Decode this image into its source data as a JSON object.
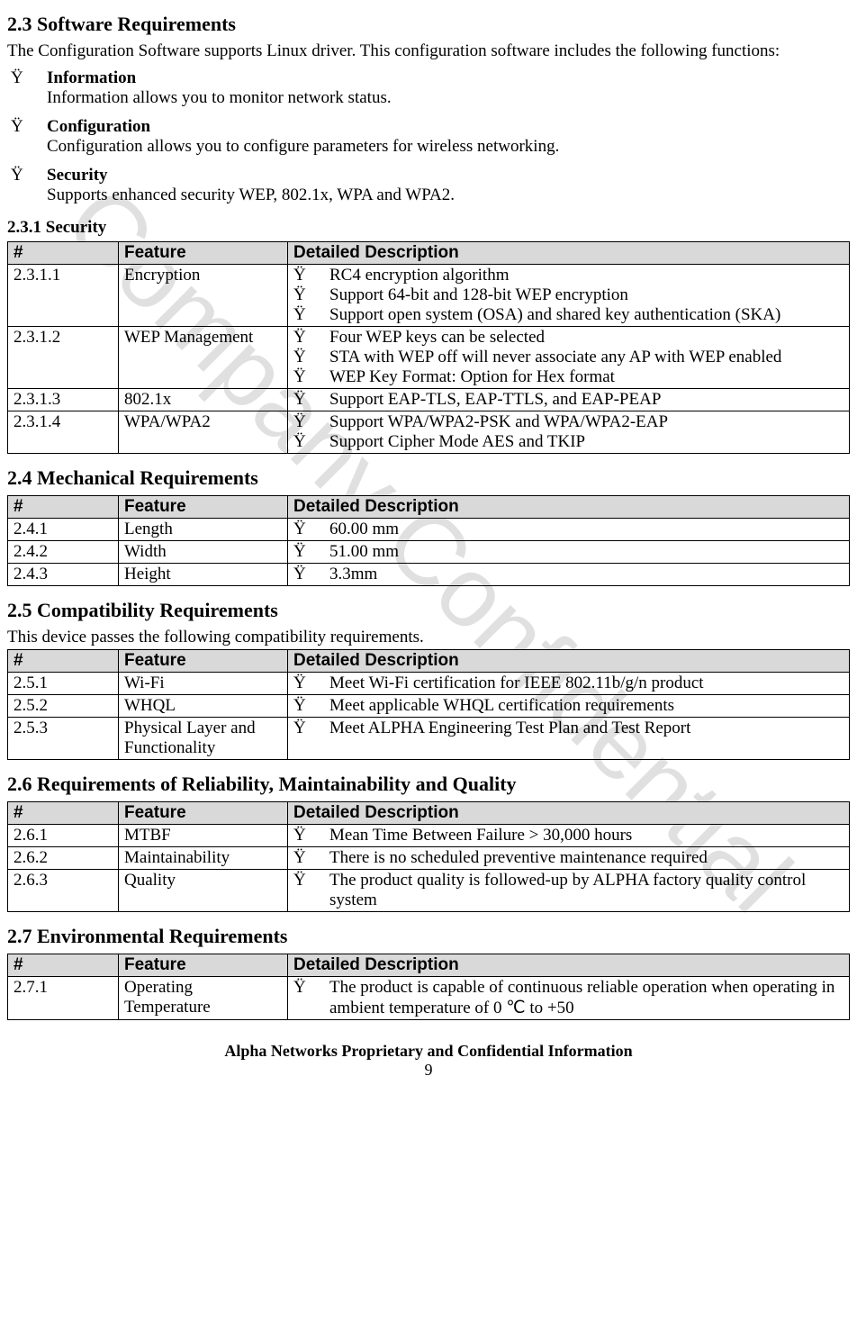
{
  "watermark": "Company Confidential",
  "sec23": {
    "title": "2.3 Software Requirements",
    "intro": "The Configuration Software supports Linux driver. This configuration software includes the following functions:",
    "features": [
      {
        "title": "Information",
        "desc": "Information allows you to monitor network status."
      },
      {
        "title": "Configuration",
        "desc": "Configuration allows you to configure parameters for wireless networking."
      },
      {
        "title": "Security",
        "desc": "Supports enhanced security WEP, 802.1x, WPA and WPA2."
      }
    ],
    "sub231": {
      "title": "2.3.1 Security",
      "headers": [
        "#",
        "Feature",
        "Detailed Description"
      ],
      "rows": [
        {
          "id": "2.3.1.1",
          "feature": "Encryption",
          "items": [
            "RC4 encryption algorithm",
            "Support 64-bit and 128-bit WEP encryption",
            "Support open system (OSA) and shared key authentication (SKA)"
          ]
        },
        {
          "id": "2.3.1.2",
          "feature": "WEP Management",
          "items": [
            "Four WEP keys can be selected",
            "STA with WEP off will never associate any AP with WEP enabled",
            "WEP Key Format: Option for Hex format"
          ]
        },
        {
          "id": "2.3.1.3",
          "feature": "802.1x",
          "items": [
            "Support EAP-TLS, EAP-TTLS, and EAP-PEAP"
          ]
        },
        {
          "id": "2.3.1.4",
          "feature": "WPA/WPA2",
          "items": [
            "Support WPA/WPA2-PSK and WPA/WPA2-EAP",
            "Support Cipher Mode AES and TKIP"
          ]
        }
      ]
    }
  },
  "sec24": {
    "title": "2.4 Mechanical Requirements",
    "headers": [
      "#",
      "Feature",
      "Detailed Description"
    ],
    "rows": [
      {
        "id": "2.4.1",
        "feature": "Length",
        "items": [
          "60.00 mm"
        ]
      },
      {
        "id": "2.4.2",
        "feature": "Width",
        "items": [
          "51.00 mm"
        ]
      },
      {
        "id": "2.4.3",
        "feature": "Height",
        "items": [
          "3.3mm"
        ]
      }
    ]
  },
  "sec25": {
    "title": "2.5 Compatibility Requirements",
    "intro": "This device passes the following compatibility requirements.",
    "headers": [
      "#",
      "Feature",
      "Detailed Description"
    ],
    "rows": [
      {
        "id": "2.5.1",
        "feature": "Wi-Fi",
        "items": [
          "Meet Wi-Fi certification for IEEE 802.11b/g/n product"
        ]
      },
      {
        "id": "2.5.2",
        "feature": "WHQL",
        "items": [
          "Meet applicable WHQL certification requirements"
        ]
      },
      {
        "id": "2.5.3",
        "feature": "Physical Layer and Functionality",
        "items": [
          "Meet ALPHA Engineering Test Plan and Test Report"
        ]
      }
    ]
  },
  "sec26": {
    "title": "2.6 Requirements of Reliability, Maintainability and Quality",
    "headers": [
      "#",
      "Feature",
      "Detailed Description"
    ],
    "rows": [
      {
        "id": "2.6.1",
        "feature": "MTBF",
        "items": [
          "Mean Time Between Failure > 30,000 hours"
        ]
      },
      {
        "id": "2.6.2",
        "feature": "Maintainability",
        "items": [
          "There is no scheduled preventive maintenance required"
        ]
      },
      {
        "id": "2.6.3",
        "feature": "Quality",
        "items": [
          "The product quality is followed-up by ALPHA factory quality control system"
        ]
      }
    ]
  },
  "sec27": {
    "title": "2.7 Environmental Requirements",
    "headers": [
      "#",
      "Feature",
      "Detailed Description"
    ],
    "rows": [
      {
        "id": "2.7.1",
        "feature": "Operating Temperature",
        "items": [
          "The product is capable of continuous reliable operation when operating in ambient temperature of 0 ℃ to +50"
        ]
      }
    ]
  },
  "footer": "Alpha Networks Proprietary and Confidential Information",
  "page": "9",
  "bullet": "Ÿ"
}
